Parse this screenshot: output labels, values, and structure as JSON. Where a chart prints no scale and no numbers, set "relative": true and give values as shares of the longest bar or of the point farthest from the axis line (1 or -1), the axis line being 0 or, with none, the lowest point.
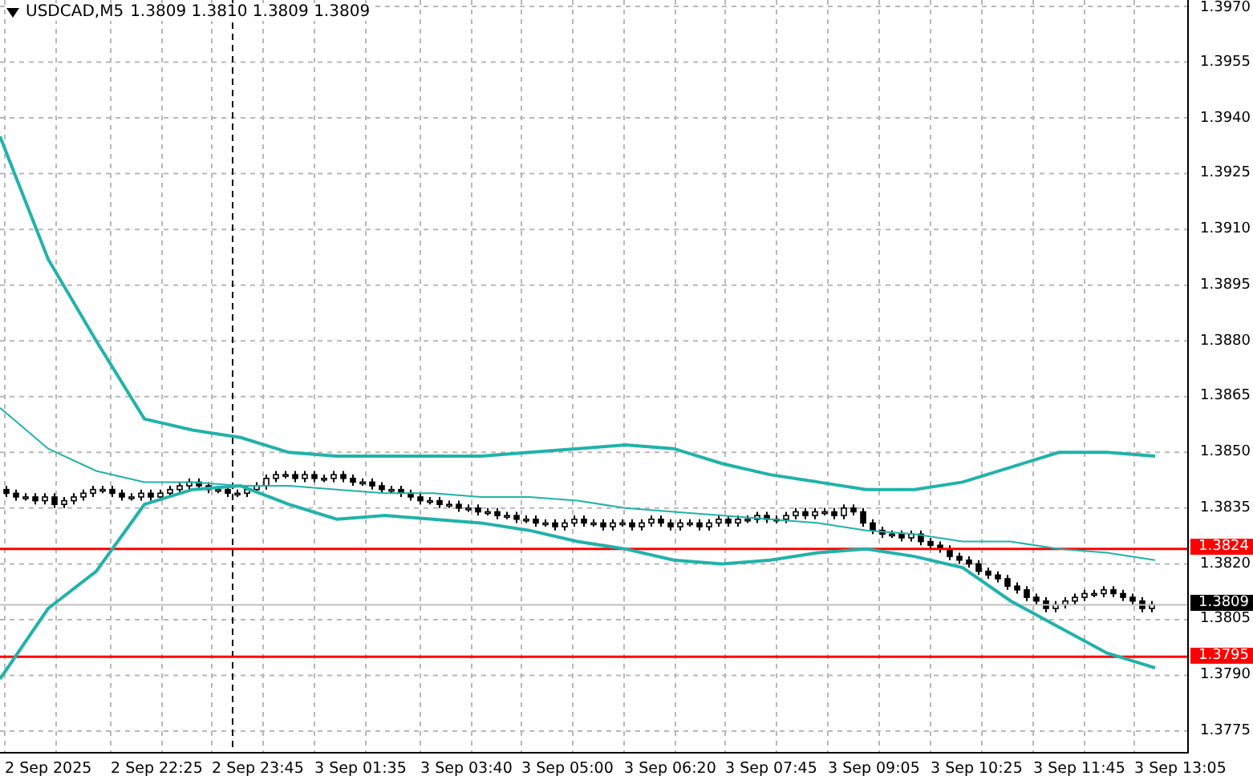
{
  "title": {
    "symbol": "USDCAD,M5",
    "quotes": "1.3809 1.3810 1.3809 1.3809"
  },
  "chart_data": {
    "type": "candlestick",
    "ylim": [
      1.3775,
      1.397
    ],
    "yticks": [
      {
        "value": 1.397,
        "label": "1.3970"
      },
      {
        "value": 1.3955,
        "label": "1.3955"
      },
      {
        "value": 1.394,
        "label": "1.3940"
      },
      {
        "value": 1.3925,
        "label": "1.3925"
      },
      {
        "value": 1.391,
        "label": "1.3910"
      },
      {
        "value": 1.3895,
        "label": "1.3895"
      },
      {
        "value": 1.388,
        "label": "1.3880"
      },
      {
        "value": 1.3865,
        "label": "1.3865"
      },
      {
        "value": 1.385,
        "label": "1.3850"
      },
      {
        "value": 1.3835,
        "label": "1.3835"
      },
      {
        "value": 1.382,
        "label": "1.3820"
      },
      {
        "value": 1.3805,
        "label": "1.3805"
      },
      {
        "value": 1.379,
        "label": "1.3790"
      },
      {
        "value": 1.3775,
        "label": "1.3775"
      }
    ],
    "grid": true,
    "ref_lines": [
      {
        "axis": "y",
        "value": 1.3824,
        "label": "1.3824",
        "color": "#ff0000"
      },
      {
        "axis": "y",
        "value": 1.3809,
        "color": "#c0c0c0"
      },
      {
        "axis": "y",
        "value": 1.3795,
        "label": "1.3795",
        "color": "#ff0000"
      }
    ],
    "ohlc": [
      [
        1.384,
        1.3841,
        1.3838,
        1.3839
      ],
      [
        1.3839,
        1.384,
        1.3837,
        1.3838
      ],
      [
        1.3838,
        1.3839,
        1.3837,
        1.3838
      ],
      [
        1.3838,
        1.3839,
        1.3836,
        1.3837
      ],
      [
        1.3837,
        1.3839,
        1.3836,
        1.3838
      ],
      [
        1.3838,
        1.3839,
        1.3835,
        1.3836
      ],
      [
        1.3836,
        1.3838,
        1.3835,
        1.3837
      ],
      [
        1.3837,
        1.3839,
        1.3836,
        1.3838
      ],
      [
        1.3838,
        1.384,
        1.3837,
        1.3839
      ],
      [
        1.3839,
        1.3841,
        1.3838,
        1.384
      ],
      [
        1.384,
        1.3841,
        1.3839,
        1.384
      ],
      [
        1.384,
        1.3841,
        1.3838,
        1.3839
      ],
      [
        1.3839,
        1.384,
        1.3837,
        1.3838
      ],
      [
        1.3838,
        1.3839,
        1.3837,
        1.3838
      ],
      [
        1.3838,
        1.384,
        1.3837,
        1.3839
      ],
      [
        1.3839,
        1.384,
        1.3837,
        1.3838
      ],
      [
        1.3838,
        1.384,
        1.3837,
        1.3839
      ],
      [
        1.3839,
        1.3841,
        1.3838,
        1.384
      ],
      [
        1.384,
        1.3842,
        1.3839,
        1.3841
      ],
      [
        1.3841,
        1.3843,
        1.384,
        1.3842
      ],
      [
        1.3842,
        1.3843,
        1.384,
        1.3841
      ],
      [
        1.3841,
        1.3842,
        1.3839,
        1.384
      ],
      [
        1.384,
        1.3841,
        1.3839,
        1.384
      ],
      [
        1.384,
        1.3841,
        1.3838,
        1.3839
      ],
      [
        1.3839,
        1.384,
        1.3838,
        1.3839
      ],
      [
        1.3839,
        1.3841,
        1.3838,
        1.384
      ],
      [
        1.384,
        1.3842,
        1.3839,
        1.3841
      ],
      [
        1.3841,
        1.3844,
        1.384,
        1.3843
      ],
      [
        1.3843,
        1.3845,
        1.3842,
        1.3844
      ],
      [
        1.3844,
        1.3845,
        1.3843,
        1.3844
      ],
      [
        1.3844,
        1.3845,
        1.3842,
        1.3843
      ],
      [
        1.3843,
        1.3845,
        1.3842,
        1.3844
      ],
      [
        1.3844,
        1.3845,
        1.3842,
        1.3843
      ],
      [
        1.3843,
        1.3844,
        1.3842,
        1.3843
      ],
      [
        1.3843,
        1.3845,
        1.3842,
        1.3844
      ],
      [
        1.3844,
        1.3845,
        1.3842,
        1.3843
      ],
      [
        1.3843,
        1.3844,
        1.3841,
        1.3842
      ],
      [
        1.3842,
        1.3843,
        1.3841,
        1.3842
      ],
      [
        1.3842,
        1.3843,
        1.384,
        1.3841
      ],
      [
        1.3841,
        1.3842,
        1.3839,
        1.384
      ],
      [
        1.384,
        1.3841,
        1.3839,
        1.384
      ],
      [
        1.384,
        1.3841,
        1.3838,
        1.3839
      ],
      [
        1.3839,
        1.384,
        1.3837,
        1.3838
      ],
      [
        1.3838,
        1.3839,
        1.3836,
        1.3837
      ],
      [
        1.3837,
        1.3838,
        1.3836,
        1.3837
      ],
      [
        1.3837,
        1.3838,
        1.3835,
        1.3836
      ],
      [
        1.3836,
        1.3837,
        1.3835,
        1.3836
      ],
      [
        1.3836,
        1.3837,
        1.3834,
        1.3835
      ],
      [
        1.3835,
        1.3836,
        1.3834,
        1.3835
      ],
      [
        1.3835,
        1.3836,
        1.3833,
        1.3834
      ],
      [
        1.3834,
        1.3835,
        1.3833,
        1.3834
      ],
      [
        1.3834,
        1.3835,
        1.3832,
        1.3833
      ],
      [
        1.3833,
        1.3834,
        1.3832,
        1.3833
      ],
      [
        1.3833,
        1.3834,
        1.3831,
        1.3832
      ],
      [
        1.3832,
        1.3833,
        1.3831,
        1.3832
      ],
      [
        1.3832,
        1.3833,
        1.383,
        1.3831
      ],
      [
        1.3831,
        1.3832,
        1.383,
        1.3831
      ],
      [
        1.3831,
        1.3832,
        1.3829,
        1.383
      ],
      [
        1.383,
        1.3832,
        1.3829,
        1.3831
      ],
      [
        1.3831,
        1.3833,
        1.383,
        1.3832
      ],
      [
        1.3832,
        1.3833,
        1.383,
        1.3831
      ],
      [
        1.3831,
        1.3832,
        1.383,
        1.3831
      ],
      [
        1.3831,
        1.3832,
        1.3829,
        1.383
      ],
      [
        1.383,
        1.3832,
        1.3829,
        1.3831
      ],
      [
        1.3831,
        1.3832,
        1.383,
        1.3831
      ],
      [
        1.3831,
        1.3832,
        1.3829,
        1.383
      ],
      [
        1.383,
        1.3832,
        1.3829,
        1.3831
      ],
      [
        1.3831,
        1.3833,
        1.383,
        1.3832
      ],
      [
        1.3832,
        1.3833,
        1.383,
        1.3831
      ],
      [
        1.3831,
        1.3832,
        1.3829,
        1.383
      ],
      [
        1.383,
        1.3832,
        1.3829,
        1.3831
      ],
      [
        1.3831,
        1.3832,
        1.383,
        1.3831
      ],
      [
        1.3831,
        1.3832,
        1.3829,
        1.383
      ],
      [
        1.383,
        1.3832,
        1.3829,
        1.3831
      ],
      [
        1.3831,
        1.3833,
        1.383,
        1.3832
      ],
      [
        1.3832,
        1.3833,
        1.383,
        1.3831
      ],
      [
        1.3831,
        1.3833,
        1.383,
        1.3832
      ],
      [
        1.3832,
        1.3833,
        1.3831,
        1.3832
      ],
      [
        1.3832,
        1.3834,
        1.3831,
        1.3833
      ],
      [
        1.3833,
        1.3834,
        1.3831,
        1.3832
      ],
      [
        1.3832,
        1.3833,
        1.3831,
        1.3832
      ],
      [
        1.3832,
        1.3834,
        1.3831,
        1.3833
      ],
      [
        1.3833,
        1.3835,
        1.3832,
        1.3834
      ],
      [
        1.3834,
        1.3835,
        1.3832,
        1.3833
      ],
      [
        1.3833,
        1.3835,
        1.3832,
        1.3834
      ],
      [
        1.3834,
        1.3835,
        1.3833,
        1.3834
      ],
      [
        1.3834,
        1.3835,
        1.3832,
        1.3833
      ],
      [
        1.3833,
        1.3836,
        1.3832,
        1.3835
      ],
      [
        1.3835,
        1.3836,
        1.3833,
        1.3834
      ],
      [
        1.3834,
        1.3835,
        1.383,
        1.3831
      ],
      [
        1.3831,
        1.3832,
        1.3828,
        1.3829
      ],
      [
        1.3829,
        1.383,
        1.3827,
        1.3828
      ],
      [
        1.3828,
        1.3829,
        1.3827,
        1.3828
      ],
      [
        1.3828,
        1.3829,
        1.3826,
        1.3827
      ],
      [
        1.3827,
        1.3829,
        1.3826,
        1.3828
      ],
      [
        1.3828,
        1.3829,
        1.3825,
        1.3826
      ],
      [
        1.3826,
        1.3827,
        1.3824,
        1.3825
      ],
      [
        1.3825,
        1.3826,
        1.3823,
        1.3824
      ],
      [
        1.3824,
        1.3825,
        1.3821,
        1.3822
      ],
      [
        1.3822,
        1.3823,
        1.382,
        1.3821
      ],
      [
        1.3821,
        1.3822,
        1.3819,
        1.382
      ],
      [
        1.382,
        1.3821,
        1.3817,
        1.3818
      ],
      [
        1.3818,
        1.3819,
        1.3816,
        1.3817
      ],
      [
        1.3817,
        1.3818,
        1.3815,
        1.3816
      ],
      [
        1.3816,
        1.3817,
        1.3813,
        1.3814
      ],
      [
        1.3814,
        1.3815,
        1.3812,
        1.3813
      ],
      [
        1.3813,
        1.3814,
        1.381,
        1.3811
      ],
      [
        1.3811,
        1.3812,
        1.3809,
        1.381
      ],
      [
        1.381,
        1.3811,
        1.3807,
        1.3808
      ],
      [
        1.3808,
        1.381,
        1.3807,
        1.3809
      ],
      [
        1.3809,
        1.3811,
        1.3808,
        1.381
      ],
      [
        1.381,
        1.3812,
        1.3809,
        1.3811
      ],
      [
        1.3811,
        1.3813,
        1.381,
        1.3812
      ],
      [
        1.3812,
        1.3813,
        1.3811,
        1.3812
      ],
      [
        1.3812,
        1.3814,
        1.3811,
        1.3813
      ],
      [
        1.3813,
        1.3814,
        1.3811,
        1.3812
      ],
      [
        1.3812,
        1.3813,
        1.381,
        1.3811
      ],
      [
        1.3811,
        1.3812,
        1.3809,
        1.381
      ],
      [
        1.381,
        1.3811,
        1.3807,
        1.3808
      ],
      [
        1.3808,
        1.381,
        1.3807,
        1.3809
      ]
    ]
  },
  "indicator": {
    "chart_data": {
      "type": "line",
      "relative": true,
      "ylim": [
        1.3775,
        1.397
      ],
      "series": [
        {
          "color": "#20b2aa",
          "values": [
            1.3935,
            1.3902,
            1.388,
            1.3859,
            1.3856,
            1.3854,
            1.385,
            1.3849,
            1.3849,
            1.3849,
            1.3849,
            1.385,
            1.3851,
            1.3852,
            1.3851,
            1.3847,
            1.3844,
            1.3842,
            1.384,
            1.384,
            1.3842,
            1.3846,
            1.385,
            1.385,
            1.3849
          ]
        },
        {
          "color": "#20b2aa",
          "values": [
            1.3862,
            1.3851,
            1.3845,
            1.3842,
            1.3842,
            1.3841,
            1.3841,
            1.384,
            1.3839,
            1.3839,
            1.3838,
            1.3838,
            1.3837,
            1.3835,
            1.3834,
            1.3833,
            1.3832,
            1.3831,
            1.3829,
            1.3828,
            1.3826,
            1.3826,
            1.3824,
            1.3823,
            1.3821
          ]
        },
        {
          "color": "#20b2aa",
          "values": [
            1.3789,
            1.3808,
            1.3818,
            1.3836,
            1.384,
            1.3841,
            1.3836,
            1.3832,
            1.3833,
            1.3832,
            1.3831,
            1.3829,
            1.3826,
            1.3824,
            1.3821,
            1.382,
            1.3821,
            1.3823,
            1.3824,
            1.3822,
            1.3819,
            1.381,
            1.3803,
            1.3796,
            1.3792
          ]
        }
      ]
    }
  },
  "current_price": {
    "label": "1.3809"
  },
  "time_axis": {
    "ticks": [
      "2 Sep 2025",
      "2 Sep 22:25",
      "2 Sep 23:45",
      "3 Sep 01:35",
      "3 Sep 03:40",
      "3 Sep 05:00",
      "3 Sep 06:20",
      "3 Sep 07:45",
      "3 Sep 09:05",
      "3 Sep 10:25",
      "3 Sep 11:45",
      "3 Sep 13:05"
    ]
  }
}
